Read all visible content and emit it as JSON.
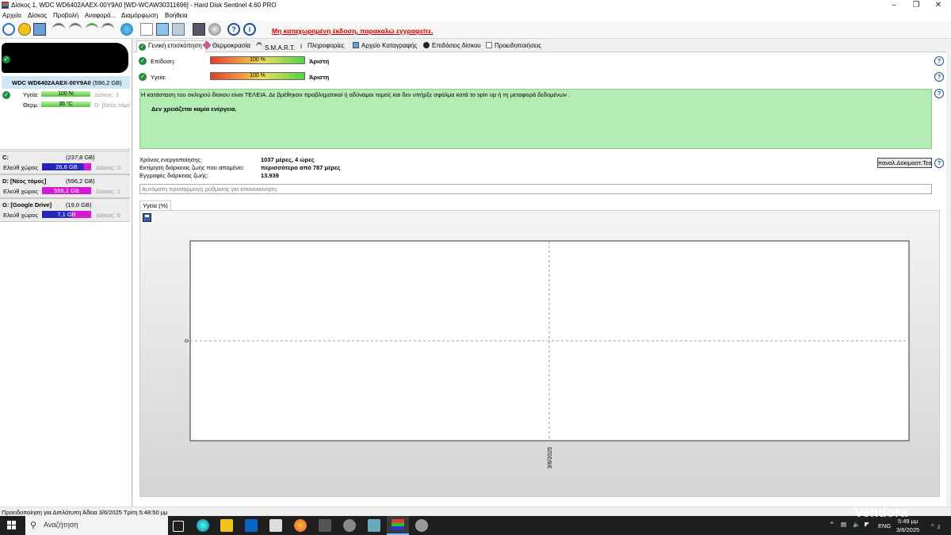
{
  "window": {
    "title": "Δίσκος 1, WDC WD6402AAEX-00Y9A0 [WD-WCAW30311696] - Hard Disk Sentinel 4.60 PRO"
  },
  "menu": [
    "Αρχείο",
    "Δίσκος",
    "Προβολή",
    "Αναφορά...",
    "Διαμόρφωση",
    "Βοήθεια"
  ],
  "toolbar": {
    "register_text": "Μη καταχωρημένη έκδοση, παρακαλώ εγγραφείτε."
  },
  "sidebar": {
    "disk": {
      "name": "WDC WD6402AAEX-00Y9A0",
      "size": "(596,2 GB)",
      "health_label": "Υγεία:",
      "health_value": "100 %",
      "health_pct": 100,
      "health_disk": "Δίσκος: 1",
      "temp_label": "Θερμ.:",
      "temp_value": "35 °C",
      "temp_drive": "D: [Νέος τόμο"
    },
    "volumes": [
      {
        "name": "C:",
        "size": "(237,8 GB)",
        "free_label": "Ελεύθ χώρος",
        "free_value": "26,8 GB",
        "disk": "Δίσκος: 0"
      },
      {
        "name": "D: [Νέος τόμος]",
        "size": "(596,2 GB)",
        "free_label": "Ελεύθ χώρος",
        "free_value": "596,1 GB",
        "disk": "Δίσκος: 1"
      },
      {
        "name": "G: [Google Drive]",
        "size": "(19,0 GB)",
        "free_label": "Ελεύθ χώρος",
        "free_value": "7,1 GB",
        "disk": "Δίσκος: 0"
      }
    ]
  },
  "tabs": [
    "Γενική επισκόπηση",
    "Θερμοκρασία",
    "S.M.A.R.T.",
    "Πληροφορίες",
    "Αρχείο Καταγραφής",
    "Επιδόσεις δίσκου",
    "Προειδοποιήσεις"
  ],
  "overview": {
    "performance_label": "Επίδοση:",
    "performance_value": "100 %",
    "performance_pct": 100,
    "performance_rating": "Άριστη",
    "health_label": "Υγεία:",
    "health_value": "100 %",
    "health_pct": 100,
    "health_rating": "Άριστη",
    "status_line1": "Η κατάσταση του σκληρού δίσκου είναι ΤΕΛΕΙΑ. Δε βρέθηκαν προβληματικοί ή αδύναμοι τομείς και δεν υπήρξε σφάλμα κατά το spin up ή τη μεταφορά δεδομένων .",
    "status_line2": "Δεν χρειάζεται καμία ενέργεια.",
    "power_on_label": "Χρόνος ενεργοποίησης:",
    "power_on_value": "1037 μέρες, 4 ώρες",
    "lifetime_label": "Εκτίμηση διάρκειας ζωής που απομένει:",
    "lifetime_value": "περισσότερο από 787 μέρες",
    "writes_label": "Εγγραφές διάρκειας ζωής:",
    "writes_value": "13.939",
    "retest_button": "παναλ.Δοκιμαστ.Τεσ",
    "auto_adjust_placeholder": "Αυτόματη προσαρμογή ρύθμισης για επανεκκίνηση"
  },
  "chart_tab": "Υγεία (%)",
  "chart_data": {
    "type": "line",
    "title": "",
    "xlabel": "",
    "ylabel": "",
    "x": [
      "3/6/2025"
    ],
    "series": [
      {
        "values": []
      }
    ],
    "y_tick_labels": [
      "0"
    ],
    "grid": true
  },
  "statusbar": {
    "text": "Προειδοποίηση για Διπλότυπη  Άδεια 3/6/2025 Τρίτη 5:48:50 μμ"
  },
  "taskbar": {
    "search_placeholder": "Αναζήτηση",
    "language": "ENG",
    "clock_time": "5:49 μμ",
    "clock_date": "3/6/2025",
    "notification_count": "2"
  },
  "watermark": "Vendora",
  "colors": {
    "ok_green": "#1f8a3a",
    "status_bg": "#b4ecb4",
    "register_red": "#cc0000",
    "accent_blue": "#1b4f9c"
  }
}
